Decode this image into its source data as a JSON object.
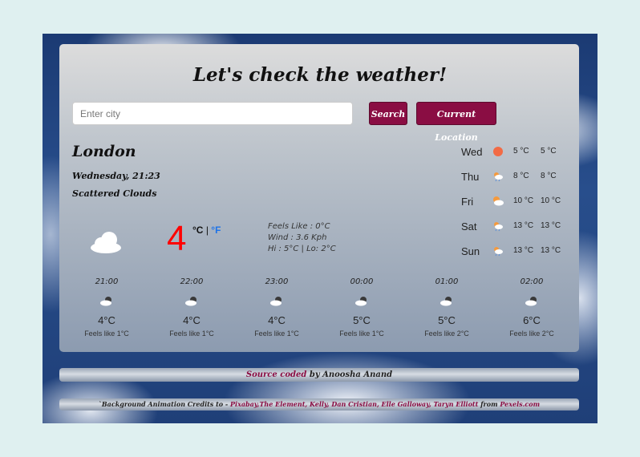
{
  "app": {
    "title": "Let's check the weather!"
  },
  "search": {
    "placeholder": "Enter city",
    "search_label": "Search",
    "current_location_label": "Current Location"
  },
  "current": {
    "city": "London",
    "datetime": "Wednesday, 21:23",
    "description": "Scattered Clouds",
    "temperature": "4",
    "unit_c": "°C",
    "unit_sep": "|",
    "unit_f": "°F",
    "feels_like": "Feels Like : 0°C",
    "wind": "Wind : 3.6 Kph",
    "hi_lo": "Hi : 5°C | Lo: 2°C",
    "icon": "cloud-icon"
  },
  "daily": [
    {
      "day": "Wed",
      "max": "5 °C",
      "min": "5 °C",
      "icon": "sun-icon"
    },
    {
      "day": "Thu",
      "max": "8 °C",
      "min": "8 °C",
      "icon": "rain-cloud-icon"
    },
    {
      "day": "Fri",
      "max": "10 °C",
      "min": "10 °C",
      "icon": "sun-cloud-icon"
    },
    {
      "day": "Sat",
      "max": "13 °C",
      "min": "13 °C",
      "icon": "rain-cloud-icon"
    },
    {
      "day": "Sun",
      "max": "13 °C",
      "min": "13 °C",
      "icon": "rain-cloud-icon"
    }
  ],
  "hourly": [
    {
      "time": "21:00",
      "temp": "4°C",
      "feels": "Feels like 1°C",
      "icon": "night-cloud-icon"
    },
    {
      "time": "22:00",
      "temp": "4°C",
      "feels": "Feels like 1°C",
      "icon": "night-cloud-icon"
    },
    {
      "time": "23:00",
      "temp": "4°C",
      "feels": "Feels like 1°C",
      "icon": "night-cloud-icon"
    },
    {
      "time": "00:00",
      "temp": "5°C",
      "feels": "Feels like 1°C",
      "icon": "night-cloud-icon"
    },
    {
      "time": "01:00",
      "temp": "5°C",
      "feels": "Feels like 2°C",
      "icon": "night-cloud-icon"
    },
    {
      "time": "02:00",
      "temp": "6°C",
      "feels": "Feels like 2°C",
      "icon": "night-cloud-icon"
    }
  ],
  "footer": {
    "source_link": "Source coded",
    "source_rest": " by Anoosha Anand",
    "credits_prefix": "`Background Animation Credits to - ",
    "credits_names": "Pixabay,The Element, Kelly, Dan Cristian, Elle Galloway, Taryn Elliott",
    "credits_mid": " from ",
    "credits_site": "Pexels.com"
  },
  "colors": {
    "accent": "#8a0d43",
    "temperature": "#ff0000",
    "unit_f": "#1e73e8"
  }
}
